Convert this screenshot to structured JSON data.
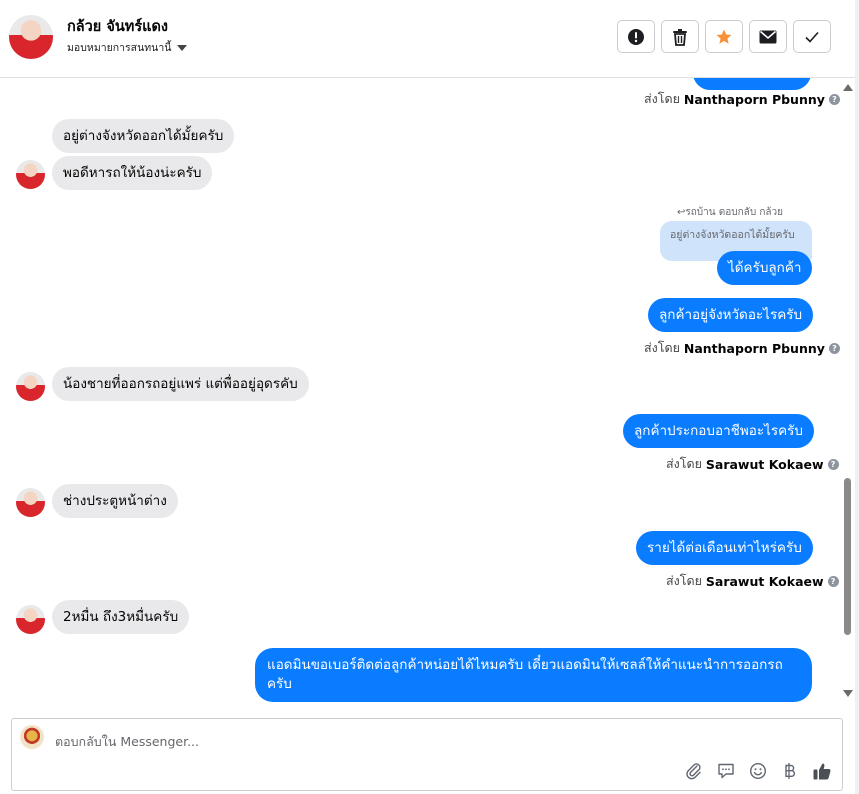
{
  "header": {
    "name": "กล้วย จันทร์แดง",
    "assign_label": "มอบหมายการสนทนานี้"
  },
  "toolbar": {
    "icons": [
      "alert-icon",
      "trash-icon",
      "star-icon",
      "mail-icon",
      "check-icon"
    ],
    "star_color": "#f7923b"
  },
  "messages": {
    "top_sent_by_prefix": "ส่งโดย",
    "top_sent_by_name": "Nanthaporn Pbunny",
    "in1": "อยู่ต่างจังหวัดออกได้มั้ยครับ",
    "in2": "พอดีหารถให้น้องน่ะครับ",
    "reply_meta": "↩รถบ้าน ตอบกลับ กล้วย",
    "quote": "อยู่ต่างจังหวัดออกได้มั้ยครับ",
    "out1": "ได้ครับลูกค้า",
    "out2": "ลูกค้าอยู่จังหวัดอะไรครับ",
    "sent2_prefix": "ส่งโดย",
    "sent2_name": "Nanthaporn Pbunny",
    "in3": "น้องชายที่ออกรถอยู่แพร่ แต่พื่ออยู่อุดรคับ",
    "out3": "ลูกค้าประกอบอาชีพอะไรครับ",
    "sent3_prefix": "ส่งโดย",
    "sent3_name": "Sarawut Kokaew",
    "in4": "ช่างประตูหน้าต่าง",
    "out4": "รายได้ต่อเดือนเท่าไหร่ครับ",
    "sent4_prefix": "ส่งโดย",
    "sent4_name": "Sarawut Kokaew",
    "in5": "2หมื่น ถึง3หมื่นครับ",
    "out5": "แอดมินขอเบอร์ติดต่อลูกค้าหน่อยได้ไหมครับ เดี๋ยวแอดมินให้เซลล์ให้คำแนะนำการออกรถครับ"
  },
  "composer": {
    "placeholder": "ตอบกลับใน Messenger...",
    "icons": [
      "attachment-icon",
      "saved-replies-icon",
      "emoji-icon",
      "baht-icon",
      "like-icon"
    ]
  },
  "colors": {
    "outgoing_bubble": "#0a7cff",
    "incoming_bubble": "#e9e9eb",
    "quote_bubble": "#cfe3fb"
  }
}
